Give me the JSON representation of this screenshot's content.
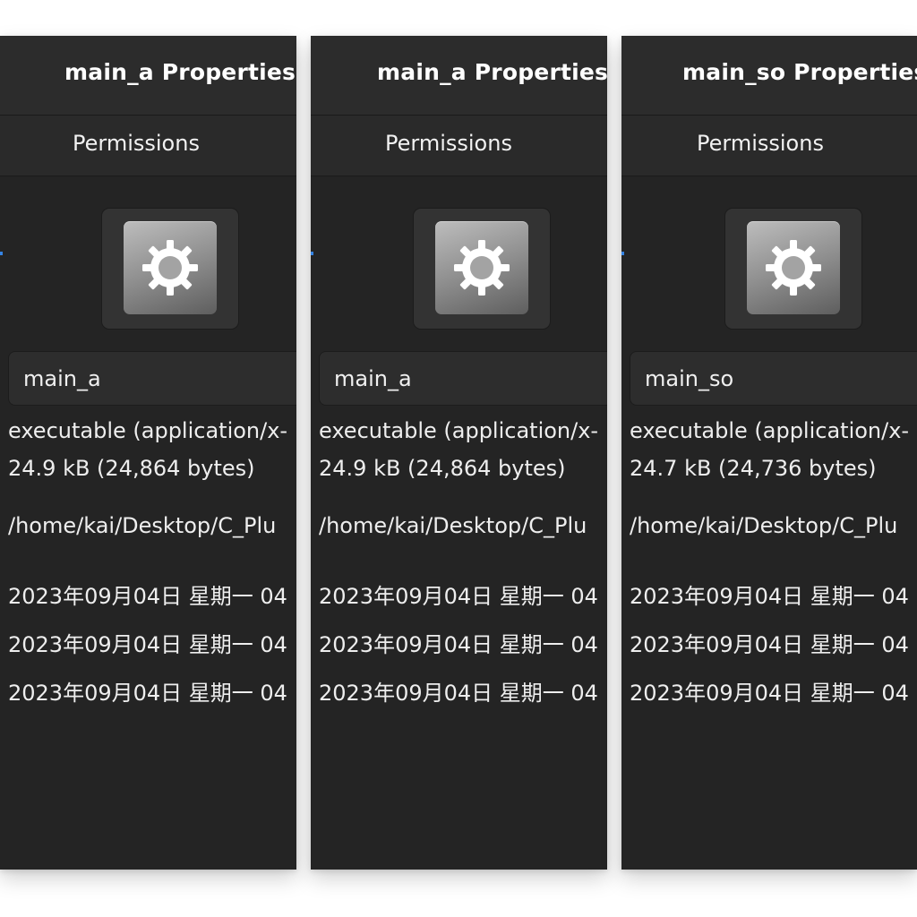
{
  "panels": [
    {
      "title": "main_a Properties",
      "tab": "Permissions",
      "icon": "gear-icon",
      "name": "main_a",
      "type": "executable (application/x-",
      "size": "24.9 kB (24,864 bytes)",
      "path": "/home/kai/Desktop/C_Plu",
      "dates": [
        "2023年09月04日 星期一 04",
        "2023年09月04日 星期一 04",
        "2023年09月04日 星期一 04"
      ]
    },
    {
      "title": "main_a Properties",
      "tab": "Permissions",
      "icon": "gear-icon",
      "name": "main_a",
      "type": "executable (application/x-",
      "size": "24.9 kB (24,864 bytes)",
      "path": "/home/kai/Desktop/C_Plu",
      "dates": [
        "2023年09月04日 星期一 04",
        "2023年09月04日 星期一 04",
        "2023年09月04日 星期一 04"
      ]
    },
    {
      "title": "main_so Properties",
      "tab": "Permissions",
      "icon": "gear-icon",
      "name": "main_so",
      "type": "executable (application/x-",
      "size": "24.7 kB (24,736 bytes)",
      "path": "/home/kai/Desktop/C_Plu",
      "dates": [
        "2023年09月04日 星期一 04",
        "2023年09月04日 星期一 04",
        "2023年09月04日 星期一 04"
      ]
    }
  ],
  "colors": {
    "window_bg": "#242424",
    "header_bg": "#2c2c2c",
    "text": "#ffffff",
    "accent": "#3584e4"
  }
}
